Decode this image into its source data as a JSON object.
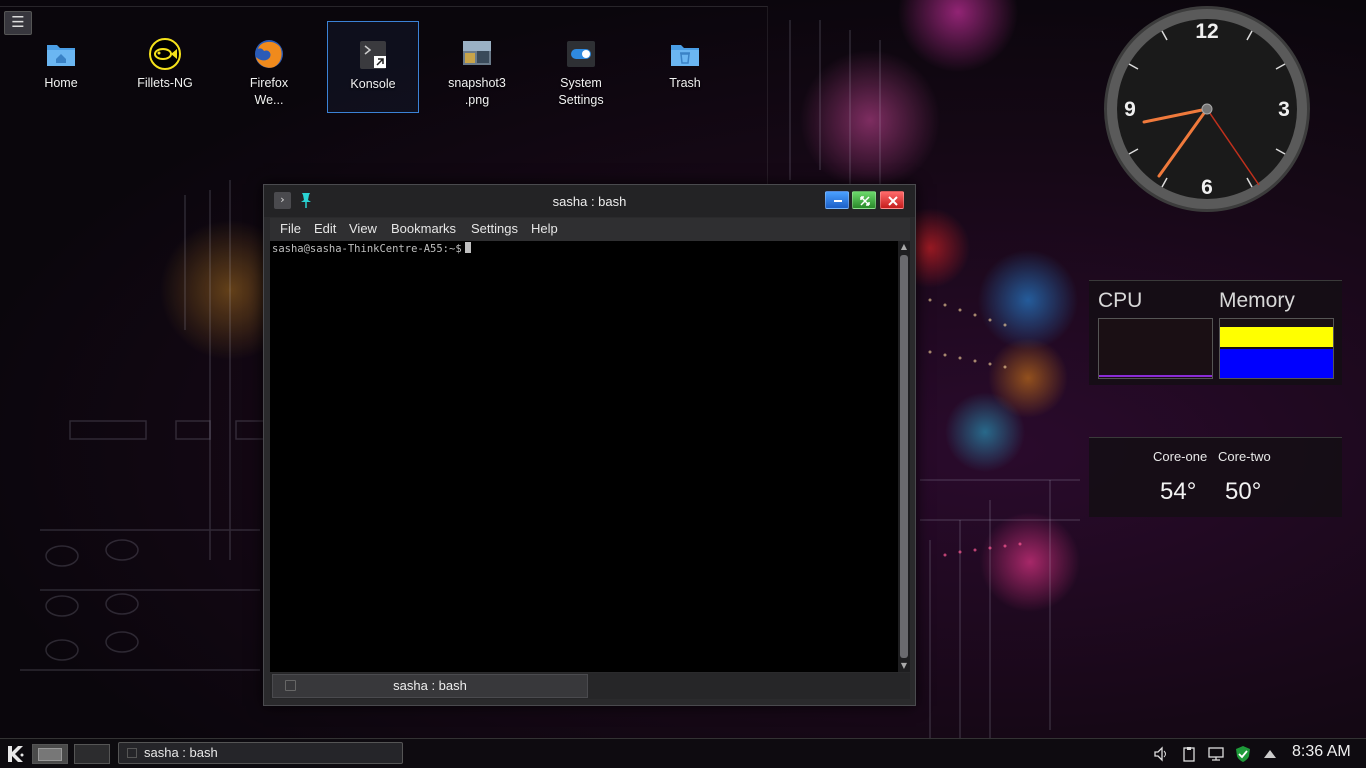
{
  "desktop": {
    "icons": [
      {
        "label": "Home",
        "icon": "home-folder-icon"
      },
      {
        "label": "Fillets-NG",
        "icon": "fish-icon"
      },
      {
        "label": "Firefox We...",
        "icon": "firefox-icon"
      },
      {
        "label": "Konsole",
        "icon": "terminal-icon"
      },
      {
        "label": "snapshot3.png",
        "icon": "image-icon"
      },
      {
        "label": "System Settings",
        "icon": "settings-toggle-icon"
      },
      {
        "label": "Trash",
        "icon": "trash-icon"
      }
    ],
    "icon_lines": {
      "firefox": [
        "Firefox",
        "We..."
      ],
      "snapshot": [
        "snapshot3",
        ".png"
      ],
      "settings": [
        "System",
        "Settings"
      ]
    },
    "menu_glyph": "☰"
  },
  "konsole": {
    "title": "sasha : bash",
    "menu": [
      "File",
      "Edit",
      "View",
      "Bookmarks",
      "Settings",
      "Help"
    ],
    "prompt": "sasha@sasha-ThinkCentre-A55:~$",
    "tab_label": "sasha : bash",
    "colors": {
      "minimize": "#1c60c8",
      "maximize": "#2a8a2a",
      "close": "#c51d1d"
    }
  },
  "clock_widget": {
    "numerals": [
      "12",
      "3",
      "6",
      "9"
    ]
  },
  "system_monitor": {
    "cpu_label": "CPU",
    "memory_label": "Memory",
    "colors": {
      "memory_used": "#ffff00",
      "memory_cache": "#0000ff",
      "cpu": "#8a2bd6"
    }
  },
  "temperatures": {
    "sensors": [
      {
        "name": "Core-one",
        "value": "54°"
      },
      {
        "name": "Core-two",
        "value": "50°"
      }
    ]
  },
  "taskbar": {
    "task_label": "sasha : bash",
    "time": "8:36 AM",
    "tray_icons": [
      "volume-icon",
      "clipboard-icon",
      "network-icon",
      "security-shield-icon",
      "show-hidden-icon"
    ]
  }
}
